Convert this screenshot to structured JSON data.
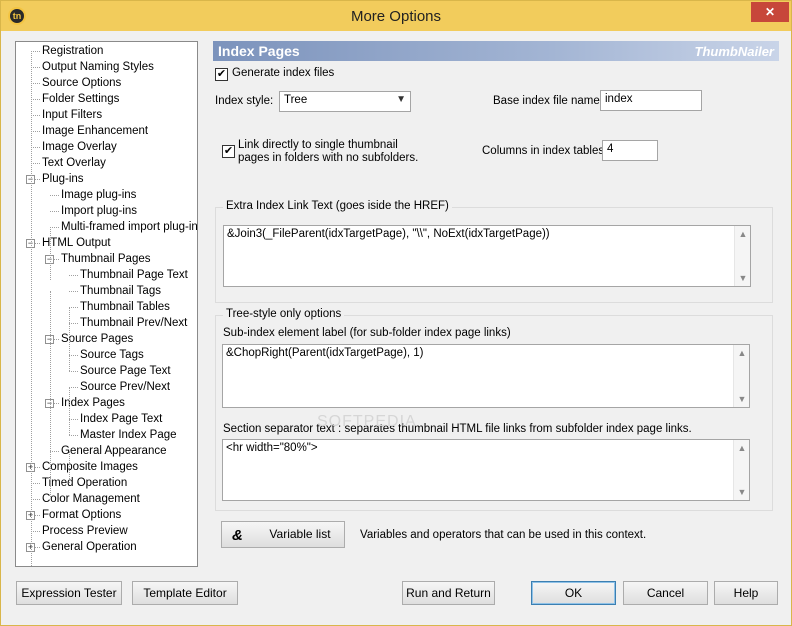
{
  "window": {
    "title": "More Options",
    "app_icon_text": "tn",
    "close_glyph": "✕"
  },
  "tree": [
    {
      "label": "Registration"
    },
    {
      "label": "Output Naming Styles"
    },
    {
      "label": "Source Options"
    },
    {
      "label": "Folder Settings"
    },
    {
      "label": "Input Filters"
    },
    {
      "label": "Image Enhancement"
    },
    {
      "label": "Image Overlay"
    },
    {
      "label": "Text Overlay"
    },
    {
      "label": "Plug-ins"
    },
    {
      "label": "Image plug-ins"
    },
    {
      "label": "Import plug-ins"
    },
    {
      "label": "Multi-framed import plug-ins"
    },
    {
      "label": "HTML Output"
    },
    {
      "label": "Thumbnail Pages"
    },
    {
      "label": "Thumbnail Page Text"
    },
    {
      "label": "Thumbnail Tags"
    },
    {
      "label": "Thumbnail Tables"
    },
    {
      "label": "Thumbnail Prev/Next"
    },
    {
      "label": "Source Pages"
    },
    {
      "label": "Source Tags"
    },
    {
      "label": "Source Page Text"
    },
    {
      "label": "Source Prev/Next"
    },
    {
      "label": "Index Pages"
    },
    {
      "label": "Index Page Text"
    },
    {
      "label": "Master Index Page"
    },
    {
      "label": "General Appearance"
    },
    {
      "label": "Composite Images"
    },
    {
      "label": "Timed Operation"
    },
    {
      "label": "Color Management"
    },
    {
      "label": "Format Options"
    },
    {
      "label": "Process Preview"
    },
    {
      "label": "General Operation"
    }
  ],
  "panel": {
    "title": "Index Pages",
    "brand": "ThumbNailer",
    "generate_index": {
      "label": "Generate index files",
      "checked": true
    },
    "index_style": {
      "label": "Index style:",
      "value": "Tree"
    },
    "base_name": {
      "label": "Base index file name:",
      "value": "index"
    },
    "link_direct": {
      "line1": "Link directly to single thumbnail",
      "line2": "pages in folders with no subfolders.",
      "checked": true
    },
    "columns": {
      "label": "Columns in index tables:",
      "value": "4"
    },
    "extra_group": {
      "title": "Extra Index Link Text (goes iside the HREF)",
      "value": "&Join3(_FileParent(idxTargetPage), \"\\\\\", NoExt(idxTargetPage))"
    },
    "tree_group": {
      "title": "Tree-style only options",
      "sub_label": "Sub-index element label (for sub-folder index page links)",
      "sub_value": "&ChopRight(Parent(idxTargetPage), 1)",
      "sep_label": "Section separator text : separates thumbnail HTML file links from subfolder index page links.",
      "sep_value": "<hr width=\"80%\">"
    },
    "variable_button": {
      "icon": "&",
      "label": "Variable list"
    },
    "variable_hint": "Variables and operators that can be used in this context."
  },
  "footer": {
    "expression_tester": "Expression Tester",
    "template_editor": "Template Editor",
    "run_return": "Run and Return",
    "ok": "OK",
    "cancel": "Cancel",
    "help": "Help"
  },
  "watermark": "SOFTPEDIA"
}
